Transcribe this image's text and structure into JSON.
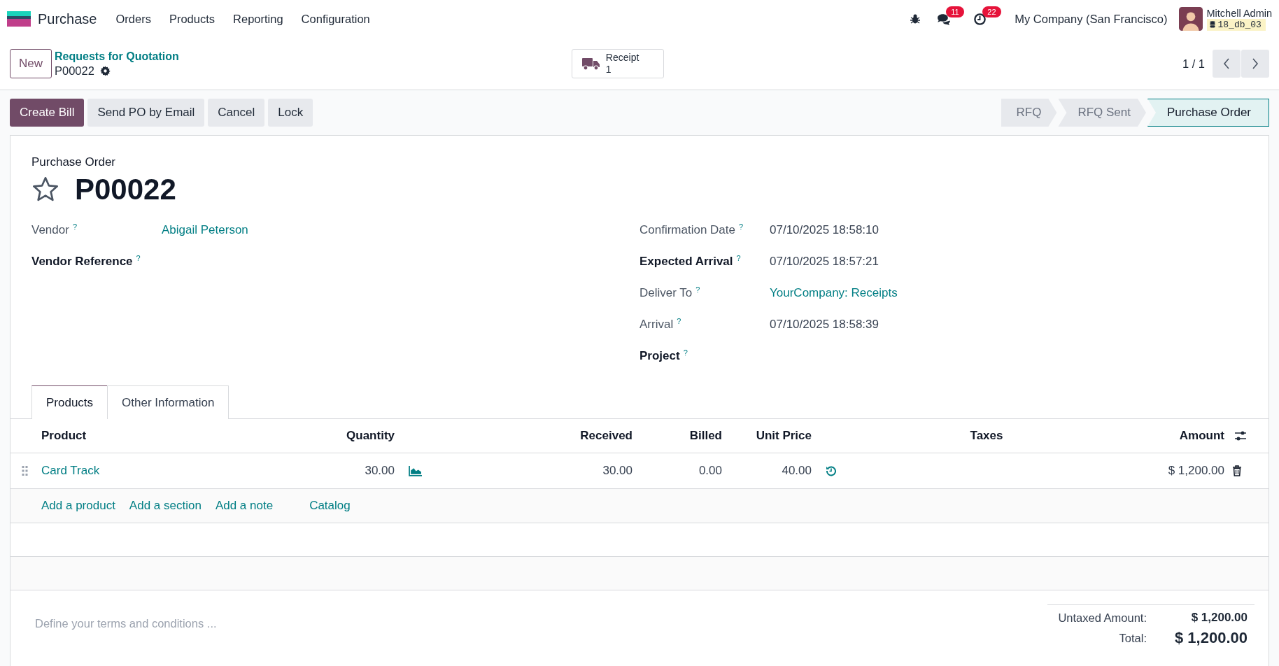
{
  "app": {
    "name": "Purchase"
  },
  "menu": [
    "Orders",
    "Products",
    "Reporting",
    "Configuration"
  ],
  "systray": {
    "messages_count": "11",
    "activities_count": "22",
    "company": "My Company (San Francisco)",
    "user": "Mitchell Admin",
    "database": "18_db_03"
  },
  "breadcrumb": {
    "parent": "Requests for Quotation",
    "current": "P00022"
  },
  "new_button": "New",
  "smart_button": {
    "label": "Receipt",
    "count": "1"
  },
  "pager": "1 / 1",
  "actions": [
    {
      "label": "Create Bill",
      "primary": true
    },
    {
      "label": "Send PO by Email",
      "primary": false
    },
    {
      "label": "Cancel",
      "primary": false
    },
    {
      "label": "Lock",
      "primary": false
    }
  ],
  "stages": [
    {
      "label": "RFQ",
      "selected": false
    },
    {
      "label": "RFQ Sent",
      "selected": false
    },
    {
      "label": "Purchase Order",
      "selected": true
    }
  ],
  "form": {
    "record_type": "Purchase Order",
    "name": "P00022",
    "starred": false,
    "left_fields": [
      {
        "label": "Vendor",
        "help": "?",
        "required": false,
        "value": "Abigail Peterson",
        "link": true
      },
      {
        "label": "Vendor Reference",
        "help": "?",
        "required": true
      }
    ],
    "right_fields": [
      {
        "label": "Confirmation Date",
        "help": "?",
        "required": false,
        "value": "07/10/2025 18:58:10",
        "link": false
      },
      {
        "label": "Expected Arrival",
        "help": "?",
        "required": true,
        "value": "07/10/2025 18:57:21",
        "link": false
      },
      {
        "label": "Deliver To",
        "help": "?",
        "required": false,
        "value": "YourCompany: Receipts",
        "link": true
      },
      {
        "label": "Arrival",
        "help": "?",
        "required": false,
        "value": "07/10/2025 18:58:39",
        "link": false
      },
      {
        "label": "Project",
        "help": "?",
        "required": true
      }
    ]
  },
  "tabs": [
    {
      "label": "Products",
      "selected": true
    },
    {
      "label": "Other Information",
      "selected": false
    }
  ],
  "table": {
    "columns": [
      "Product",
      "Quantity",
      "Received",
      "Billed",
      "Unit Price",
      "Taxes",
      "Amount"
    ],
    "rows": [
      {
        "product": "Card Track",
        "quantity": "30.00",
        "received": "30.00",
        "billed": "0.00",
        "unit_price": "40.00",
        "amount": "$ 1,200.00"
      }
    ],
    "add_links": [
      "Add a product",
      "Add a section",
      "Add a note",
      "Catalog"
    ]
  },
  "terms": {
    "placeholder": "Define your terms and conditions ..."
  },
  "totals": [
    {
      "kind": "subtotal",
      "label": "Untaxed Amount:",
      "value": "$ 1,200.00"
    },
    {
      "kind": "total",
      "label": "Total:",
      "value": "$ 1,200.00"
    }
  ]
}
